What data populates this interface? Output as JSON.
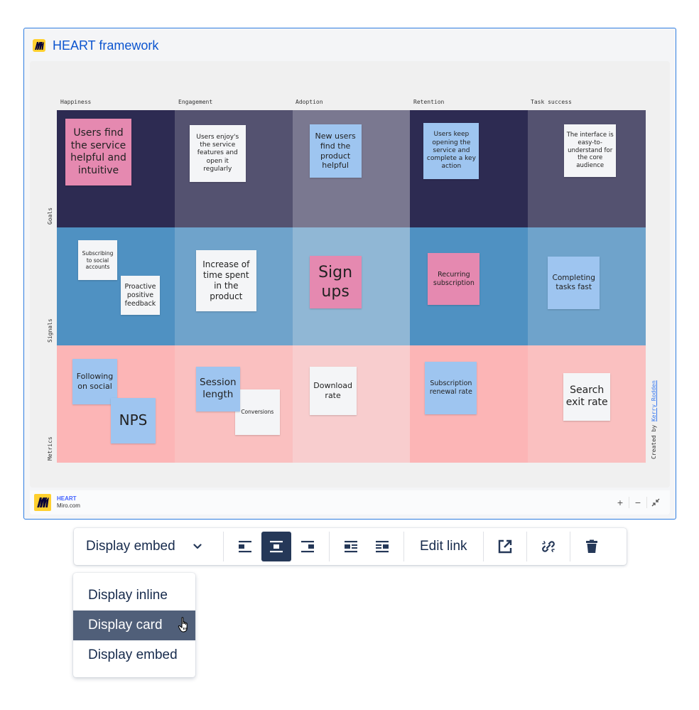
{
  "embed": {
    "title": "HEART framework",
    "accent": "#0c55cf",
    "columns": [
      "Happiness",
      "Engagement",
      "Adoption",
      "Retention",
      "Task success"
    ],
    "rows": [
      "Goals",
      "Signals",
      "Metrics"
    ],
    "cell_colors": [
      [
        "#2d2b52",
        "#545270",
        "#7a7890",
        "#2d2b52",
        "#545270"
      ],
      [
        "#4f91c2",
        "#6fa3cb",
        "#90b7d5",
        "#4f91c2",
        "#6fa3cb"
      ],
      [
        "#fcb5b6",
        "#fac0c0",
        "#f8cdce",
        "#fcb5b6",
        "#fac0c0"
      ]
    ],
    "stickies": {
      "goals_happiness": "Users find the service helpful and intuitive",
      "goals_engagement": "Users enjoy's the service features and open it regularly",
      "goals_adoption": "New users find the product helpful",
      "goals_retention": "Users keep opening the service and complete a key action",
      "goals_task": "The interface is easy-to-understand for the core audience",
      "signals_happiness_1": "Subscribing to social accounts",
      "signals_happiness_2": "Proactive positive feedback",
      "signals_engagement": "Increase of time spent in the product",
      "signals_adoption": "Sign ups",
      "signals_retention": "Recurring subscription",
      "signals_task": "Completing tasks fast",
      "metrics_happiness_1": "Following on social",
      "metrics_happiness_2": "NPS",
      "metrics_engagement_1": "Session length",
      "metrics_engagement_2": "Conversions",
      "metrics_adoption": "Download rate",
      "metrics_retention": "Subscription renewal rate",
      "metrics_task": "Search exit rate"
    },
    "credit_prefix": "Created by ",
    "credit_author": "Kerry Rodden",
    "footer": {
      "title": "HEART",
      "subtitle": "Miro.com",
      "zoom_in": "+",
      "zoom_out": "−",
      "collapse_icon": "collapse-arrows-icon"
    }
  },
  "toolbar": {
    "display_mode": "Display embed",
    "edit_link": "Edit link",
    "icons": [
      "align-left-icon",
      "align-center-icon",
      "align-right-icon",
      "wrap-left-icon",
      "wrap-right-icon",
      "open-external-icon",
      "unlink-icon",
      "trash-icon"
    ],
    "active_alignment": "align-center"
  },
  "menu": {
    "items": [
      "Display inline",
      "Display card",
      "Display embed"
    ],
    "selected": "Display card"
  }
}
